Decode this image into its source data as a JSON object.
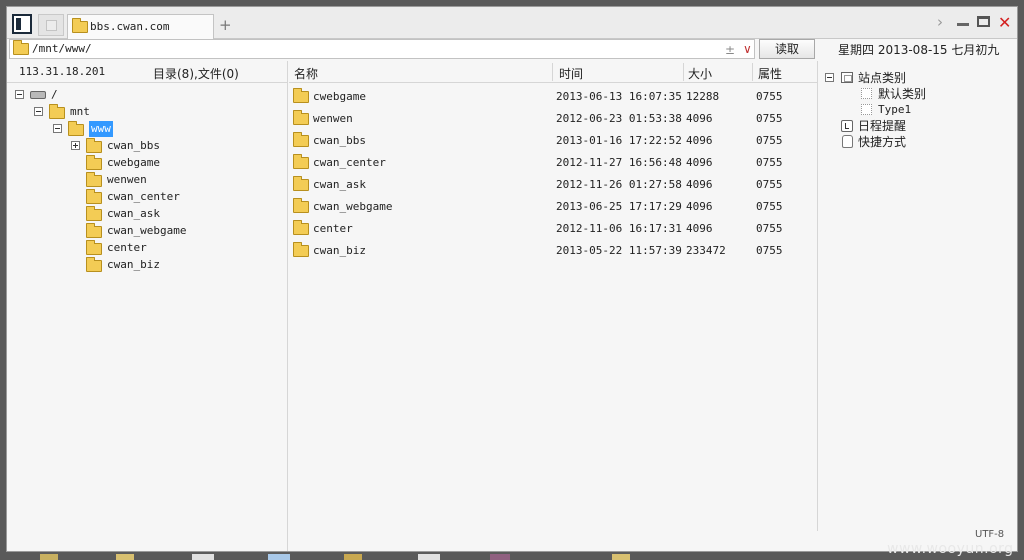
{
  "tab": {
    "title": "bbs.cwan.com",
    "new_tab": "+"
  },
  "window": {
    "next": "›",
    "close": "✕"
  },
  "address": {
    "path": "/mnt/www/",
    "plus": "±",
    "chevron": "∨",
    "read_label": "读取"
  },
  "date_text": "星期四 2013-08-15 七月初九",
  "left": {
    "ip": "113.31.18.201",
    "summary": "目录(8),文件(0)",
    "tree": [
      {
        "label": "/",
        "level": 0,
        "icon": "drive-icon",
        "expander": "minus"
      },
      {
        "label": "mnt",
        "level": 1,
        "icon": "folder-icon",
        "expander": "minus"
      },
      {
        "label": "www",
        "level": 2,
        "icon": "folder-icon",
        "expander": "minus",
        "selected": true
      },
      {
        "label": "cwan_bbs",
        "level": 3,
        "icon": "folder-icon",
        "expander": "plus"
      },
      {
        "label": "cwebgame",
        "level": 3,
        "icon": "folder-icon",
        "expander": "none"
      },
      {
        "label": "wenwen",
        "level": 3,
        "icon": "folder-icon",
        "expander": "none"
      },
      {
        "label": "cwan_center",
        "level": 3,
        "icon": "folder-icon",
        "expander": "none"
      },
      {
        "label": "cwan_ask",
        "level": 3,
        "icon": "folder-icon",
        "expander": "none"
      },
      {
        "label": "cwan_webgame",
        "level": 3,
        "icon": "folder-icon",
        "expander": "none"
      },
      {
        "label": "center",
        "level": 3,
        "icon": "folder-icon",
        "expander": "none"
      },
      {
        "label": "cwan_biz",
        "level": 3,
        "icon": "folder-icon",
        "expander": "none"
      }
    ]
  },
  "files": {
    "headers": {
      "name": "名称",
      "time": "时间",
      "size": "大小",
      "attr": "属性"
    },
    "rows": [
      {
        "name": "cwebgame",
        "time": "2013-06-13 16:07:35",
        "size": "12288",
        "attr": "0755"
      },
      {
        "name": "wenwen",
        "time": "2012-06-23 01:53:38",
        "size": "4096",
        "attr": "0755"
      },
      {
        "name": "cwan_bbs",
        "time": "2013-01-16 17:22:52",
        "size": "4096",
        "attr": "0755"
      },
      {
        "name": "cwan_center",
        "time": "2012-11-27 16:56:48",
        "size": "4096",
        "attr": "0755"
      },
      {
        "name": "cwan_ask",
        "time": "2012-11-26 01:27:58",
        "size": "4096",
        "attr": "0755"
      },
      {
        "name": "cwan_webgame",
        "time": "2013-06-25 17:17:29",
        "size": "4096",
        "attr": "0755"
      },
      {
        "name": "center",
        "time": "2012-11-06 16:17:31",
        "size": "4096",
        "attr": "0755"
      },
      {
        "name": "cwan_biz",
        "time": "2013-05-22 11:57:39",
        "size": "233472",
        "attr": "0755"
      }
    ]
  },
  "right": {
    "site_category": "站点类别",
    "default_category": "默认类别",
    "type1": "Type1",
    "schedule": "日程提醒",
    "shortcuts": "快捷方式"
  },
  "status": {
    "encoding": "UTF-8"
  },
  "watermark": "www.wooyun.org"
}
